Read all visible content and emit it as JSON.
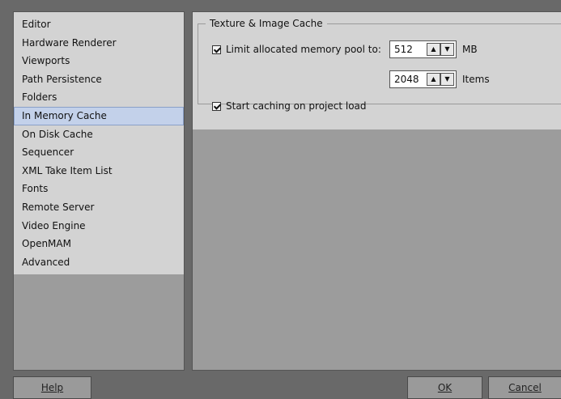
{
  "sidebar": {
    "items": [
      {
        "label": "Editor"
      },
      {
        "label": "Hardware Renderer"
      },
      {
        "label": "Viewports"
      },
      {
        "label": "Path Persistence"
      },
      {
        "label": "Folders"
      },
      {
        "label": "In Memory Cache",
        "selected": true
      },
      {
        "label": "On Disk Cache"
      },
      {
        "label": "Sequencer"
      },
      {
        "label": "XML Take Item List"
      },
      {
        "label": "Fonts"
      },
      {
        "label": "Remote Server"
      },
      {
        "label": "Video Engine"
      },
      {
        "label": "OpenMAM"
      },
      {
        "label": "Advanced"
      }
    ]
  },
  "cache_group": {
    "title": "Texture & Image Cache",
    "limit_pool": {
      "label": "Limit allocated memory pool to:",
      "checked": true
    },
    "memory": {
      "value": "512",
      "unit": "MB"
    },
    "items": {
      "value": "2048",
      "unit": "Items"
    },
    "start_caching": {
      "label": "Start caching on project load",
      "checked": true
    }
  },
  "buttons": {
    "help": "Help",
    "ok": "OK",
    "cancel": "Cancel"
  },
  "colors": {
    "selection": "#c3d1ea",
    "panel": "#d3d3d3",
    "background": "#696969"
  }
}
